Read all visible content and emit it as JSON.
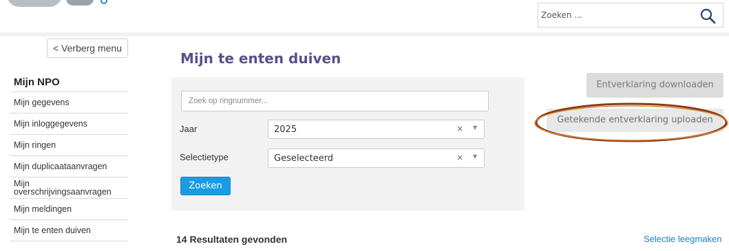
{
  "header": {
    "search_placeholder": "Zoeken ...",
    "search_icon": "search-icon"
  },
  "sidebar": {
    "hide_menu_label": "< Verberg menu",
    "section_title": "Mijn NPO",
    "items": [
      {
        "label": "Mijn gegevens"
      },
      {
        "label": "Mijn inloggegevens"
      },
      {
        "label": "Mijn ringen"
      },
      {
        "label": "Mijn duplicaataanvragen"
      },
      {
        "label": "Mijn overschrijvingsaanvragen"
      },
      {
        "label": "Mijn meldingen"
      },
      {
        "label": "Mijn te enten duiven"
      }
    ]
  },
  "main": {
    "page_title": "Mijn te enten duiven",
    "filters": {
      "ring_placeholder": "Zoek op ringnummer...",
      "year_label": "Jaar",
      "year_value": "2025",
      "selection_type_label": "Selectietype",
      "selection_type_value": "Geselecteerd",
      "clear_glyph": "×",
      "dropdown_glyph": "▼",
      "search_button_label": "Zoeken"
    },
    "actions": {
      "download_label": "Entverklaring downloaden",
      "upload_label": "Getekende entverklaring uploaden"
    },
    "results_text": "14 Resultaten gevonden",
    "clear_selection_label": "Selectie leegmaken"
  },
  "colors": {
    "title_purple": "#5b4f8a",
    "primary_blue": "#1a9be3",
    "link_blue": "#1a7fc9",
    "highlight_ellipse": "#8a3b12"
  }
}
